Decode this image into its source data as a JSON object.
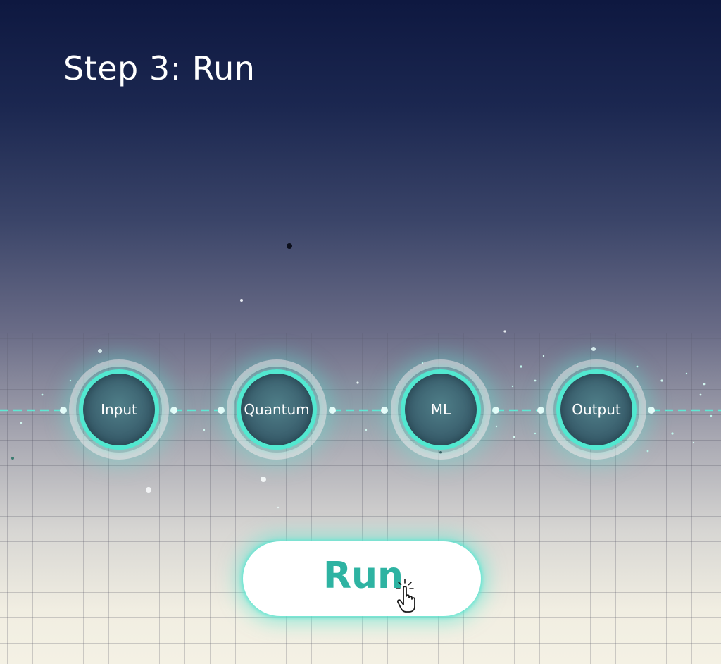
{
  "header": {
    "title": "Step 3: Run"
  },
  "pipeline": {
    "nodes": [
      {
        "label": "Input"
      },
      {
        "label": "Quantum"
      },
      {
        "label": "ML"
      },
      {
        "label": "Output"
      }
    ]
  },
  "action": {
    "run_label": "Run",
    "cursor_icon": "hand-pointer-icon"
  },
  "colors": {
    "accent": "#52e8d0",
    "run_text": "#2eb3a2",
    "background_top": "#0e1840",
    "background_bottom": "#f4f1e4"
  }
}
